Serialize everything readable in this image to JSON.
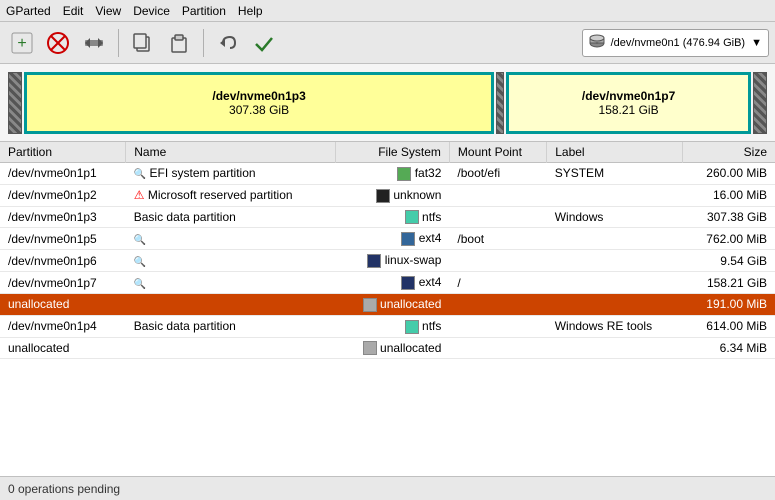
{
  "menubar": {
    "items": [
      "GParted",
      "Edit",
      "View",
      "Device",
      "Partition",
      "Help"
    ]
  },
  "toolbar": {
    "buttons": [
      {
        "name": "new-partition-button",
        "icon": "➕",
        "label": "New"
      },
      {
        "name": "delete-partition-button",
        "icon": "🚫",
        "label": "Delete"
      },
      {
        "name": "resize-partition-button",
        "icon": "⊣",
        "label": "Resize"
      },
      {
        "name": "copy-partition-button",
        "icon": "⎘",
        "label": "Copy"
      },
      {
        "name": "paste-partition-button",
        "icon": "📋",
        "label": "Paste"
      },
      {
        "name": "undo-button",
        "icon": "↩",
        "label": "Undo"
      },
      {
        "name": "apply-button",
        "icon": "✔",
        "label": "Apply"
      }
    ],
    "device": {
      "icon": "💿",
      "label": "/dev/nvme0n1 (476.94 GiB)",
      "dropdown_icon": "▼"
    }
  },
  "partition_visual": {
    "p3": {
      "name": "/dev/nvme0n1p3",
      "size": "307.38 GiB",
      "selected": true
    },
    "p7": {
      "name": "/dev/nvme0n1p7",
      "size": "158.21 GiB",
      "selected": true
    }
  },
  "table": {
    "headers": [
      "Partition",
      "Name",
      "File System",
      "Mount Point",
      "Label",
      "Size"
    ],
    "rows": [
      {
        "partition": "/dev/nvme0n1p1",
        "name": "EFI system partition",
        "name_icon": "🔍",
        "fs_color": "#55aa55",
        "filesystem": "fat32",
        "mount_point": "/boot/efi",
        "label": "SYSTEM",
        "size": "260.00 MiB",
        "highlighted": false
      },
      {
        "partition": "/dev/nvme0n1p2",
        "name": "Microsoft reserved partition",
        "name_icon": "⚠",
        "fs_color": "#222222",
        "filesystem": "unknown",
        "mount_point": "",
        "label": "",
        "size": "16.00 MiB",
        "highlighted": false
      },
      {
        "partition": "/dev/nvme0n1p3",
        "name": "Basic data partition",
        "name_icon": "",
        "fs_color": "#44ccaa",
        "filesystem": "ntfs",
        "mount_point": "",
        "label": "Windows",
        "size": "307.38 GiB",
        "highlighted": false
      },
      {
        "partition": "/dev/nvme0n1p5",
        "name": "",
        "name_icon": "🔍",
        "fs_color": "#336699",
        "filesystem": "ext4",
        "mount_point": "/boot",
        "label": "",
        "size": "762.00 MiB",
        "highlighted": false
      },
      {
        "partition": "/dev/nvme0n1p6",
        "name": "",
        "name_icon": "🔍",
        "fs_color": "#223366",
        "filesystem": "linux-swap",
        "mount_point": "",
        "label": "",
        "size": "9.54 GiB",
        "highlighted": false
      },
      {
        "partition": "/dev/nvme0n1p7",
        "name": "",
        "name_icon": "🔍",
        "fs_color": "#223366",
        "filesystem": "ext4",
        "mount_point": "/",
        "label": "",
        "size": "158.21 GiB",
        "highlighted": false
      },
      {
        "partition": "unallocated",
        "name": "",
        "name_icon": "",
        "fs_color": "#aaaaaa",
        "filesystem": "unallocated",
        "mount_point": "",
        "label": "",
        "size": "191.00 MiB",
        "highlighted": true
      },
      {
        "partition": "/dev/nvme0n1p4",
        "name": "Basic data partition",
        "name_icon": "",
        "fs_color": "#44ccaa",
        "filesystem": "ntfs",
        "mount_point": "",
        "label": "Windows RE tools",
        "size": "614.00 MiB",
        "highlighted": false
      },
      {
        "partition": "unallocated",
        "name": "",
        "name_icon": "",
        "fs_color": "#aaaaaa",
        "filesystem": "unallocated",
        "mount_point": "",
        "label": "",
        "size": "6.34 MiB",
        "highlighted": false
      }
    ]
  },
  "statusbar": {
    "text": "0 operations pending"
  }
}
